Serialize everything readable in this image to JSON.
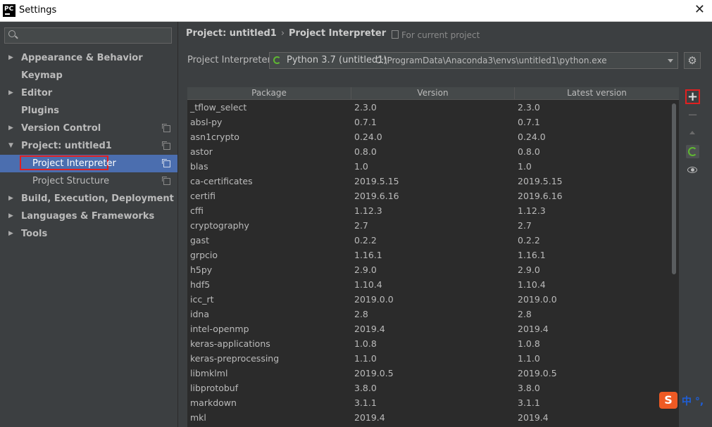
{
  "window": {
    "title": "Settings",
    "logo_text": "PC",
    "close_glyph": "✕"
  },
  "sidebar": {
    "search_placeholder": "",
    "items": [
      {
        "label": "Appearance & Behavior",
        "arrow": "▶",
        "level": 0
      },
      {
        "label": "Keymap",
        "arrow": "",
        "level": 0
      },
      {
        "label": "Editor",
        "arrow": "▶",
        "level": 0
      },
      {
        "label": "Plugins",
        "arrow": "",
        "level": 0
      },
      {
        "label": "Version Control",
        "arrow": "▶",
        "level": 0,
        "copy_icon": true
      },
      {
        "label": "Project: untitled1",
        "arrow": "▼",
        "level": 0,
        "copy_icon": true
      },
      {
        "label": "Project Interpreter",
        "arrow": "",
        "level": 1,
        "copy_icon": true,
        "selected": true
      },
      {
        "label": "Project Structure",
        "arrow": "",
        "level": 1,
        "copy_icon": true
      },
      {
        "label": "Build, Execution, Deployment",
        "arrow": "▶",
        "level": 0
      },
      {
        "label": "Languages & Frameworks",
        "arrow": "▶",
        "level": 0
      },
      {
        "label": "Tools",
        "arrow": "▶",
        "level": 0
      }
    ]
  },
  "breadcrumb": {
    "parent": "Project: untitled1",
    "separator": "›",
    "current": "Project Interpreter"
  },
  "scope_label": "For current project",
  "interpreter": {
    "label": "Project Interpreter:",
    "name": "Python 3.7 (untitled1)",
    "path": "C:\\ProgramData\\Anaconda3\\envs\\untitled1\\python.exe"
  },
  "table": {
    "headers": [
      "Package",
      "Version",
      "Latest version"
    ],
    "rows": [
      [
        "_tflow_select",
        "2.3.0",
        "2.3.0"
      ],
      [
        "absl-py",
        "0.7.1",
        "0.7.1"
      ],
      [
        "asn1crypto",
        "0.24.0",
        "0.24.0"
      ],
      [
        "astor",
        "0.8.0",
        "0.8.0"
      ],
      [
        "blas",
        "1.0",
        "1.0"
      ],
      [
        "ca-certificates",
        "2019.5.15",
        "2019.5.15"
      ],
      [
        "certifi",
        "2019.6.16",
        "2019.6.16"
      ],
      [
        "cffi",
        "1.12.3",
        "1.12.3"
      ],
      [
        "cryptography",
        "2.7",
        "2.7"
      ],
      [
        "gast",
        "0.2.2",
        "0.2.2"
      ],
      [
        "grpcio",
        "1.16.1",
        "1.16.1"
      ],
      [
        "h5py",
        "2.9.0",
        "2.9.0"
      ],
      [
        "hdf5",
        "1.10.4",
        "1.10.4"
      ],
      [
        "icc_rt",
        "2019.0.0",
        "2019.0.0"
      ],
      [
        "idna",
        "2.8",
        "2.8"
      ],
      [
        "intel-openmp",
        "2019.4",
        "2019.4"
      ],
      [
        "keras-applications",
        "1.0.8",
        "1.0.8"
      ],
      [
        "keras-preprocessing",
        "1.1.0",
        "1.1.0"
      ],
      [
        "libmklml",
        "2019.0.5",
        "2019.0.5"
      ],
      [
        "libprotobuf",
        "3.8.0",
        "3.8.0"
      ],
      [
        "markdown",
        "3.1.1",
        "3.1.1"
      ],
      [
        "mkl",
        "2019.4",
        "2019.4"
      ]
    ]
  },
  "toolbar": {
    "add_glyph": "+",
    "remove_glyph": "−"
  },
  "ime": {
    "logo": "S",
    "text": "中 °,"
  },
  "colors": {
    "selection": "#4b6eaf",
    "highlight_box": "#e02020",
    "spinner": "#5fb832",
    "ime_logo": "#ee5a24",
    "ime_text": "#1e5fd8"
  }
}
